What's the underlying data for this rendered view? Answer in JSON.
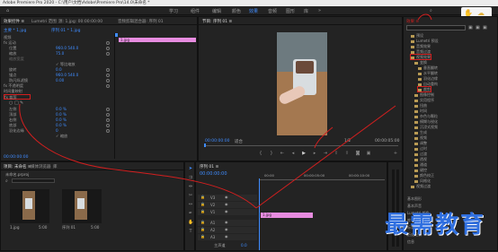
{
  "titlebar": {
    "text": "Adobe Premiere Pro 2020 - C:\\用户\\文档\\Adobe\\Premiere Pro\\14.0\\未命名 *"
  },
  "workspaces": [
    {
      "label": "学习",
      "active": false
    },
    {
      "label": "组件",
      "active": false
    },
    {
      "label": "编辑",
      "active": false
    },
    {
      "label": "颜色",
      "active": false
    },
    {
      "label": "效果",
      "active": true
    },
    {
      "label": "音频",
      "active": false
    },
    {
      "label": "图形",
      "active": false
    },
    {
      "label": "库",
      "active": false
    }
  ],
  "effect_controls": {
    "tabs": [
      "效果控件 ≡",
      "Lumetri 范围",
      "源: 1.jpg: 00:00:00:00",
      "音频剪辑混合器: 序列 01"
    ],
    "clip_label": "主要 * 1.jpg",
    "seq_label": "序列 01 * 1.jpg",
    "timecode": "00:00:00:00",
    "properties": [
      {
        "label": "视频",
        "value": ""
      },
      {
        "label": "fx 运动",
        "value": ""
      },
      {
        "label": "位置",
        "value": "960.0  540.0"
      },
      {
        "label": "缩放",
        "value": "75.0"
      },
      {
        "label": "缩放宽度",
        "value": ""
      },
      {
        "label": "",
        "value": "✓ 等比缩放"
      },
      {
        "label": "旋转",
        "value": "0.0"
      },
      {
        "label": "锚点",
        "value": "960.0  540.0"
      },
      {
        "label": "防闪烁滤镜",
        "value": "0.00"
      },
      {
        "label": "fx 不透明度",
        "value": ""
      },
      {
        "label": "时间重映射",
        "value": ""
      },
      {
        "label": "fx 裁剪",
        "value": ""
      },
      {
        "label": "左侧",
        "value": "0.0 %"
      },
      {
        "label": "顶部",
        "value": "0.0 %"
      },
      {
        "label": "右侧",
        "value": "0.0 %"
      },
      {
        "label": "底部",
        "value": "0.0 %"
      },
      {
        "label": "羽化边缘",
        "value": "0"
      },
      {
        "label": "",
        "value": "✓ 缩放"
      }
    ],
    "clip_bar_label": "1.jpg"
  },
  "program_monitor": {
    "tab": "节目: 序列 01 ≡",
    "timecode_left": "00:00:00:00",
    "fit": "适合",
    "scale": "1/2",
    "timecode_right": "00:00:05:00"
  },
  "effects_panel": {
    "tab": "效果 ≡",
    "search_placeholder": "",
    "tree": [
      {
        "label": "预设",
        "indent": 1,
        "highlight": false
      },
      {
        "label": "Lumetri 预设",
        "indent": 1,
        "highlight": false
      },
      {
        "label": "音频效果",
        "indent": 1,
        "highlight": false
      },
      {
        "label": "音频过渡",
        "indent": 1,
        "highlight": false
      },
      {
        "label": "视频效果",
        "indent": 1,
        "highlight": true
      },
      {
        "label": "变换",
        "indent": 2,
        "highlight": false
      },
      {
        "label": "垂直翻转",
        "indent": 3,
        "highlight": false
      },
      {
        "label": "水平翻转",
        "indent": 3,
        "highlight": false
      },
      {
        "label": "羽化边缘",
        "indent": 3,
        "highlight": false
      },
      {
        "label": "自动重构",
        "indent": 3,
        "highlight": false
      },
      {
        "label": "裁剪",
        "indent": 3,
        "highlight": true
      },
      {
        "label": "图像控制",
        "indent": 2,
        "highlight": false
      },
      {
        "label": "实用程序",
        "indent": 2,
        "highlight": false
      },
      {
        "label": "扭曲",
        "indent": 2,
        "highlight": false
      },
      {
        "label": "时间",
        "indent": 2,
        "highlight": false
      },
      {
        "label": "杂色与颗粒",
        "indent": 2,
        "highlight": false
      },
      {
        "label": "模糊与锐化",
        "indent": 2,
        "highlight": false
      },
      {
        "label": "沉浸式视频",
        "indent": 2,
        "highlight": false
      },
      {
        "label": "生成",
        "indent": 2,
        "highlight": false
      },
      {
        "label": "视频",
        "indent": 2,
        "highlight": false
      },
      {
        "label": "调整",
        "indent": 2,
        "highlight": false
      },
      {
        "label": "过时",
        "indent": 2,
        "highlight": false
      },
      {
        "label": "过渡",
        "indent": 2,
        "highlight": false
      },
      {
        "label": "透视",
        "indent": 2,
        "highlight": false
      },
      {
        "label": "通道",
        "indent": 2,
        "highlight": false
      },
      {
        "label": "键控",
        "indent": 2,
        "highlight": false
      },
      {
        "label": "颜色校正",
        "indent": 2,
        "highlight": false
      },
      {
        "label": "风格化",
        "indent": 2,
        "highlight": false
      },
      {
        "label": "视频过渡",
        "indent": 1,
        "highlight": false
      }
    ],
    "lower_sections": [
      "基本图形",
      "基本声音",
      "Lumetri 颜色",
      "库",
      "标记",
      "历史记录",
      "信息"
    ]
  },
  "project_panel": {
    "tabs": [
      "项目: 未命名 ≡",
      "媒体浏览器",
      "库"
    ],
    "path": "未命名.prproj",
    "items": [
      {
        "name": "1.jpg",
        "duration": "5:00"
      },
      {
        "name": "序列 01",
        "duration": "5:00"
      }
    ]
  },
  "timeline": {
    "tab": "序列 01 ≡",
    "timecode": "00:00:00:00",
    "ruler": [
      "00:00",
      "00:00:05:00",
      "00:00:10:00"
    ],
    "video_tracks": [
      "V3",
      "V2",
      "V1"
    ],
    "audio_tracks": [
      "A1",
      "A2",
      "A3"
    ],
    "master": "主声道",
    "master_value": "0.0",
    "clip_label": "1.jpg"
  },
  "watermark": {
    "text": "最需教育"
  },
  "colors": {
    "accent": "#3f8cff",
    "clip": "#e78ce0",
    "annotation": "#d21f1f"
  }
}
